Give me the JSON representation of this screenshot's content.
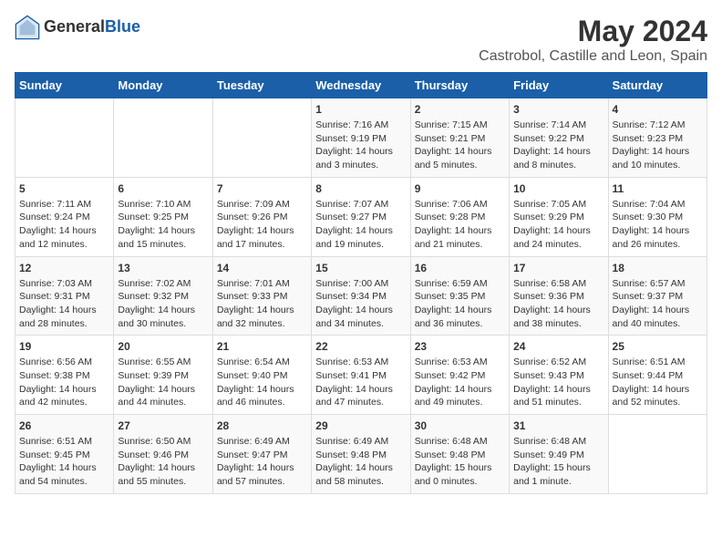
{
  "header": {
    "logo_general": "General",
    "logo_blue": "Blue",
    "title": "May 2024",
    "subtitle": "Castrobol, Castille and Leon, Spain"
  },
  "days_of_week": [
    "Sunday",
    "Monday",
    "Tuesday",
    "Wednesday",
    "Thursday",
    "Friday",
    "Saturday"
  ],
  "weeks": [
    [
      {
        "day": "",
        "sunrise": "",
        "sunset": "",
        "daylight": ""
      },
      {
        "day": "",
        "sunrise": "",
        "sunset": "",
        "daylight": ""
      },
      {
        "day": "",
        "sunrise": "",
        "sunset": "",
        "daylight": ""
      },
      {
        "day": "1",
        "sunrise": "Sunrise: 7:16 AM",
        "sunset": "Sunset: 9:19 PM",
        "daylight": "Daylight: 14 hours and 3 minutes."
      },
      {
        "day": "2",
        "sunrise": "Sunrise: 7:15 AM",
        "sunset": "Sunset: 9:21 PM",
        "daylight": "Daylight: 14 hours and 5 minutes."
      },
      {
        "day": "3",
        "sunrise": "Sunrise: 7:14 AM",
        "sunset": "Sunset: 9:22 PM",
        "daylight": "Daylight: 14 hours and 8 minutes."
      },
      {
        "day": "4",
        "sunrise": "Sunrise: 7:12 AM",
        "sunset": "Sunset: 9:23 PM",
        "daylight": "Daylight: 14 hours and 10 minutes."
      }
    ],
    [
      {
        "day": "5",
        "sunrise": "Sunrise: 7:11 AM",
        "sunset": "Sunset: 9:24 PM",
        "daylight": "Daylight: 14 hours and 12 minutes."
      },
      {
        "day": "6",
        "sunrise": "Sunrise: 7:10 AM",
        "sunset": "Sunset: 9:25 PM",
        "daylight": "Daylight: 14 hours and 15 minutes."
      },
      {
        "day": "7",
        "sunrise": "Sunrise: 7:09 AM",
        "sunset": "Sunset: 9:26 PM",
        "daylight": "Daylight: 14 hours and 17 minutes."
      },
      {
        "day": "8",
        "sunrise": "Sunrise: 7:07 AM",
        "sunset": "Sunset: 9:27 PM",
        "daylight": "Daylight: 14 hours and 19 minutes."
      },
      {
        "day": "9",
        "sunrise": "Sunrise: 7:06 AM",
        "sunset": "Sunset: 9:28 PM",
        "daylight": "Daylight: 14 hours and 21 minutes."
      },
      {
        "day": "10",
        "sunrise": "Sunrise: 7:05 AM",
        "sunset": "Sunset: 9:29 PM",
        "daylight": "Daylight: 14 hours and 24 minutes."
      },
      {
        "day": "11",
        "sunrise": "Sunrise: 7:04 AM",
        "sunset": "Sunset: 9:30 PM",
        "daylight": "Daylight: 14 hours and 26 minutes."
      }
    ],
    [
      {
        "day": "12",
        "sunrise": "Sunrise: 7:03 AM",
        "sunset": "Sunset: 9:31 PM",
        "daylight": "Daylight: 14 hours and 28 minutes."
      },
      {
        "day": "13",
        "sunrise": "Sunrise: 7:02 AM",
        "sunset": "Sunset: 9:32 PM",
        "daylight": "Daylight: 14 hours and 30 minutes."
      },
      {
        "day": "14",
        "sunrise": "Sunrise: 7:01 AM",
        "sunset": "Sunset: 9:33 PM",
        "daylight": "Daylight: 14 hours and 32 minutes."
      },
      {
        "day": "15",
        "sunrise": "Sunrise: 7:00 AM",
        "sunset": "Sunset: 9:34 PM",
        "daylight": "Daylight: 14 hours and 34 minutes."
      },
      {
        "day": "16",
        "sunrise": "Sunrise: 6:59 AM",
        "sunset": "Sunset: 9:35 PM",
        "daylight": "Daylight: 14 hours and 36 minutes."
      },
      {
        "day": "17",
        "sunrise": "Sunrise: 6:58 AM",
        "sunset": "Sunset: 9:36 PM",
        "daylight": "Daylight: 14 hours and 38 minutes."
      },
      {
        "day": "18",
        "sunrise": "Sunrise: 6:57 AM",
        "sunset": "Sunset: 9:37 PM",
        "daylight": "Daylight: 14 hours and 40 minutes."
      }
    ],
    [
      {
        "day": "19",
        "sunrise": "Sunrise: 6:56 AM",
        "sunset": "Sunset: 9:38 PM",
        "daylight": "Daylight: 14 hours and 42 minutes."
      },
      {
        "day": "20",
        "sunrise": "Sunrise: 6:55 AM",
        "sunset": "Sunset: 9:39 PM",
        "daylight": "Daylight: 14 hours and 44 minutes."
      },
      {
        "day": "21",
        "sunrise": "Sunrise: 6:54 AM",
        "sunset": "Sunset: 9:40 PM",
        "daylight": "Daylight: 14 hours and 46 minutes."
      },
      {
        "day": "22",
        "sunrise": "Sunrise: 6:53 AM",
        "sunset": "Sunset: 9:41 PM",
        "daylight": "Daylight: 14 hours and 47 minutes."
      },
      {
        "day": "23",
        "sunrise": "Sunrise: 6:53 AM",
        "sunset": "Sunset: 9:42 PM",
        "daylight": "Daylight: 14 hours and 49 minutes."
      },
      {
        "day": "24",
        "sunrise": "Sunrise: 6:52 AM",
        "sunset": "Sunset: 9:43 PM",
        "daylight": "Daylight: 14 hours and 51 minutes."
      },
      {
        "day": "25",
        "sunrise": "Sunrise: 6:51 AM",
        "sunset": "Sunset: 9:44 PM",
        "daylight": "Daylight: 14 hours and 52 minutes."
      }
    ],
    [
      {
        "day": "26",
        "sunrise": "Sunrise: 6:51 AM",
        "sunset": "Sunset: 9:45 PM",
        "daylight": "Daylight: 14 hours and 54 minutes."
      },
      {
        "day": "27",
        "sunrise": "Sunrise: 6:50 AM",
        "sunset": "Sunset: 9:46 PM",
        "daylight": "Daylight: 14 hours and 55 minutes."
      },
      {
        "day": "28",
        "sunrise": "Sunrise: 6:49 AM",
        "sunset": "Sunset: 9:47 PM",
        "daylight": "Daylight: 14 hours and 57 minutes."
      },
      {
        "day": "29",
        "sunrise": "Sunrise: 6:49 AM",
        "sunset": "Sunset: 9:48 PM",
        "daylight": "Daylight: 14 hours and 58 minutes."
      },
      {
        "day": "30",
        "sunrise": "Sunrise: 6:48 AM",
        "sunset": "Sunset: 9:48 PM",
        "daylight": "Daylight: 15 hours and 0 minutes."
      },
      {
        "day": "31",
        "sunrise": "Sunrise: 6:48 AM",
        "sunset": "Sunset: 9:49 PM",
        "daylight": "Daylight: 15 hours and 1 minute."
      },
      {
        "day": "",
        "sunrise": "",
        "sunset": "",
        "daylight": ""
      }
    ]
  ]
}
